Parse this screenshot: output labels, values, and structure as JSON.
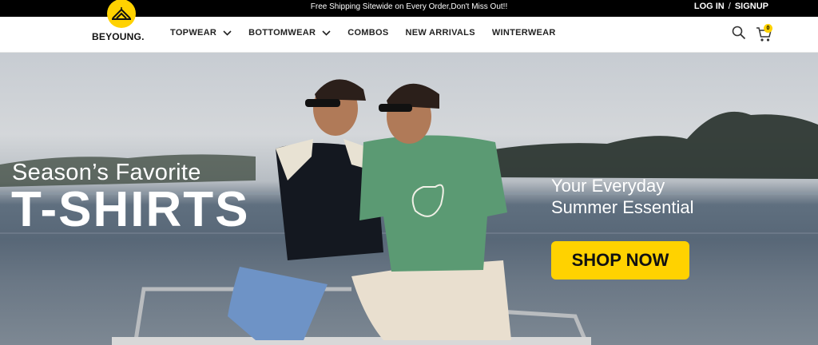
{
  "topbar": {
    "promo": "Free Shipping Sitewide on Every Order,Don't Miss Out!!",
    "login": "LOG IN",
    "separator": "/",
    "signup": "SIGNUP"
  },
  "brand": {
    "name": "BEYOUNG.",
    "accent_color": "#ffd200"
  },
  "nav": {
    "items": [
      {
        "label": "TOPWEAR",
        "has_dropdown": true
      },
      {
        "label": "BOTTOMWEAR",
        "has_dropdown": true
      },
      {
        "label": "COMBOS",
        "has_dropdown": false
      },
      {
        "label": "NEW ARRIVALS",
        "has_dropdown": false
      },
      {
        "label": "WINTERWEAR",
        "has_dropdown": false
      }
    ]
  },
  "header_icons": {
    "search_icon": "search-icon",
    "cart_icon": "cart-icon",
    "cart_count": "0"
  },
  "hero": {
    "title_line_1": "Season’s Favorite",
    "title_line_2": "T-SHIRTS",
    "tagline_line_1": "Your Everyday",
    "tagline_line_2": "Summer Essential",
    "cta_label": "SHOP NOW"
  }
}
